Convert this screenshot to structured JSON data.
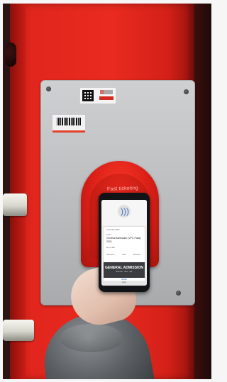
{
  "scene": {
    "description_colors": {
      "door": "#e92a20",
      "plate": "#bfc0c2",
      "phone": "#111317",
      "sleeve": "#5b5f63"
    }
  },
  "reader": {
    "brand": "Fast ticketing"
  },
  "phone_screen": {
    "nfc_icon": "nfc-icon",
    "ticket_header": "Contactless PDF",
    "ticket_label": "Ticket",
    "ticket_title": "General Admission (VFC Pass)",
    "ticket_title_2": "2021",
    "row_1": "Event date",
    "row_2_left": "Admission",
    "row_2_mid": "Gate",
    "row_2_right": "Entrance",
    "admission_type": "GENERAL ADMISSION",
    "admission_sub": "Barcode · NFC · QR",
    "button_label": "MORE",
    "bottom_label": "Close"
  }
}
